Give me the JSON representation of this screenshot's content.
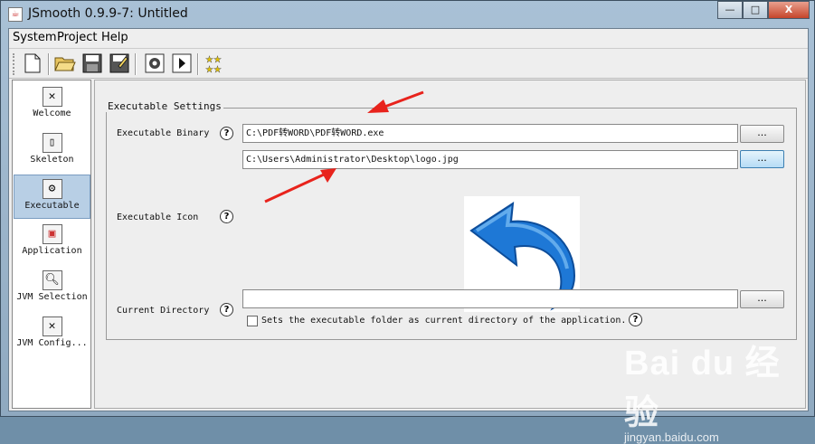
{
  "window": {
    "title": "JSmooth 0.9.9-7: Untitled"
  },
  "window_buttons": {
    "minimize": "—",
    "maximize": "□",
    "close": "X"
  },
  "menu": [
    "System",
    "Project",
    "Help"
  ],
  "toolbar_icons": [
    "new-file-icon",
    "open-folder-icon",
    "save-icon",
    "save-as-icon",
    "compile-gear-icon",
    "run-icon",
    "about-stars-icon"
  ],
  "sidebar": {
    "items": [
      {
        "label": "Welcome",
        "icon": "welcome-icon"
      },
      {
        "label": "Skeleton",
        "icon": "skeleton-icon"
      },
      {
        "label": "Executable",
        "icon": "executable-gear-icon",
        "selected": true
      },
      {
        "label": "Application",
        "icon": "application-icon"
      },
      {
        "label": "JVM Selection",
        "icon": "jvm-selection-icon"
      },
      {
        "label": "JVM Config...",
        "icon": "jvm-config-icon"
      }
    ]
  },
  "settings": {
    "group_title": "Executable Settings",
    "binary_label": "Executable Binary",
    "binary_value": "C:\\PDF转WORD\\PDF转WORD.exe",
    "icon_label": "Executable Icon",
    "icon_value": "C:\\Users\\Administrator\\Desktop\\logo.jpg",
    "curdir_label": "Current Directory",
    "curdir_value": "",
    "curdir_checkbox_label": "Sets the executable folder as current directory of the application.",
    "curdir_checked": false,
    "browse_label": "...",
    "help_mark": "?"
  },
  "watermark": {
    "main": "Bai du 经验",
    "sub": "jingyan.baidu.com"
  },
  "colors": {
    "annotation_arrow": "#e8231c",
    "icon_arrow": "#1e78d6",
    "selected_item": "#b8cfe5"
  }
}
